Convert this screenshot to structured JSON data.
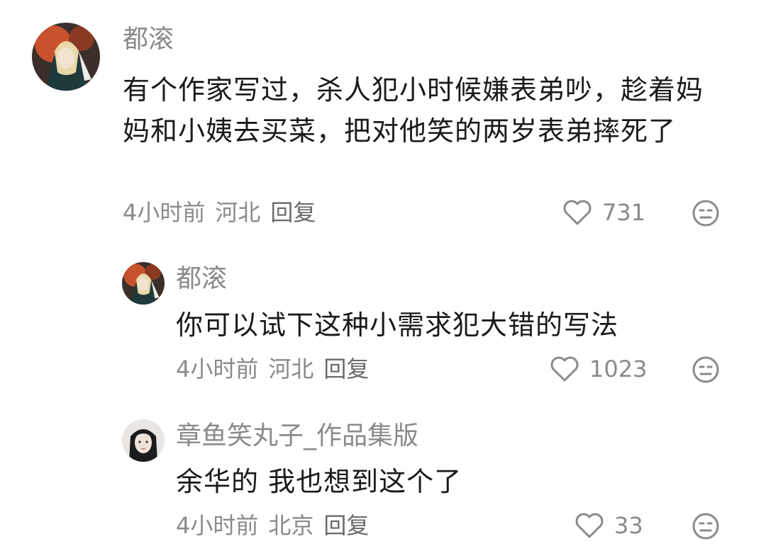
{
  "comments": [
    {
      "username": "都滚",
      "text": "有个作家写过，杀人犯小时候嫌表弟吵，趁着妈妈和小姨去买菜，把对他笑的两岁表弟摔死了",
      "time": "4小时前",
      "location": "河北",
      "reply_label": "回复",
      "likes": "731",
      "avatar_icon": "anime-avatar-icon"
    },
    {
      "username": "都滚",
      "text": "你可以试下这种小需求犯大错的写法",
      "time": "4小时前",
      "location": "河北",
      "reply_label": "回复",
      "likes": "1023",
      "avatar_icon": "anime-avatar-icon"
    },
    {
      "username": "章鱼笑丸子_作品集版",
      "text": "余华的 我也想到这个了",
      "time": "4小时前",
      "location": "北京",
      "reply_label": "回复",
      "likes": "33",
      "avatar_icon": "portrait-avatar-icon"
    }
  ],
  "icons": {
    "like": "heart-outline-icon",
    "reaction": "neutral-face-icon"
  },
  "colors": {
    "text": "#1a1a1a",
    "muted": "#8a8a8a"
  }
}
